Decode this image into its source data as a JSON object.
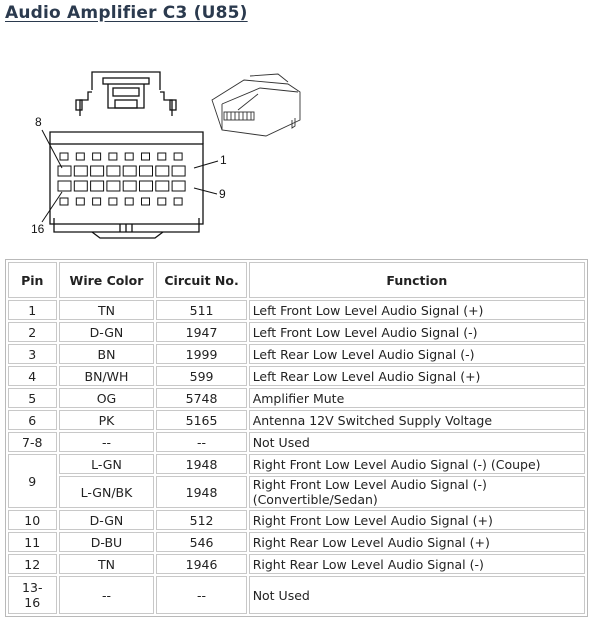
{
  "title": "Audio Amplifier C3 (U85)",
  "diagram": {
    "callouts": [
      "8",
      "1",
      "9",
      "16"
    ]
  },
  "table": {
    "headers": {
      "pin": "Pin",
      "wire_color": "Wire Color",
      "circuit": "Circuit No.",
      "function": "Function"
    },
    "rows": [
      {
        "pin": "1",
        "wire": "TN",
        "circuit": "511",
        "function": "Left Front Low Level Audio Signal (+)"
      },
      {
        "pin": "2",
        "wire": "D-GN",
        "circuit": "1947",
        "function": "Left Front Low Level Audio Signal (-)"
      },
      {
        "pin": "3",
        "wire": "BN",
        "circuit": "1999",
        "function": "Left Rear Low Level Audio Signal (-)"
      },
      {
        "pin": "4",
        "wire": "BN/WH",
        "circuit": "599",
        "function": "Left Rear Low Level Audio Signal (+)"
      },
      {
        "pin": "5",
        "wire": "OG",
        "circuit": "5748",
        "function": "Amplifier Mute"
      },
      {
        "pin": "6",
        "wire": "PK",
        "circuit": "5165",
        "function": "Antenna 12V Switched Supply Voltage"
      },
      {
        "pin": "7-8",
        "wire": "--",
        "circuit": "--",
        "function": "Not Used"
      },
      {
        "pin": "9",
        "wire": "L-GN",
        "circuit": "1948",
        "function": "Right Front Low Level Audio Signal (-) (Coupe)"
      },
      {
        "pin": "",
        "wire": "L-GN/BK",
        "circuit": "1948",
        "function": "Right Front Low Level Audio Signal (-) (Convertible/Sedan)"
      },
      {
        "pin": "10",
        "wire": "D-GN",
        "circuit": "512",
        "function": "Right Front Low Level Audio Signal (+)"
      },
      {
        "pin": "11",
        "wire": "D-BU",
        "circuit": "546",
        "function": "Right Rear Low Level Audio Signal (+)"
      },
      {
        "pin": "12",
        "wire": "TN",
        "circuit": "1946",
        "function": "Right Rear Low Level Audio Signal (-)"
      },
      {
        "pin": "13-16",
        "wire": "--",
        "circuit": "--",
        "function": "Not Used"
      }
    ]
  }
}
